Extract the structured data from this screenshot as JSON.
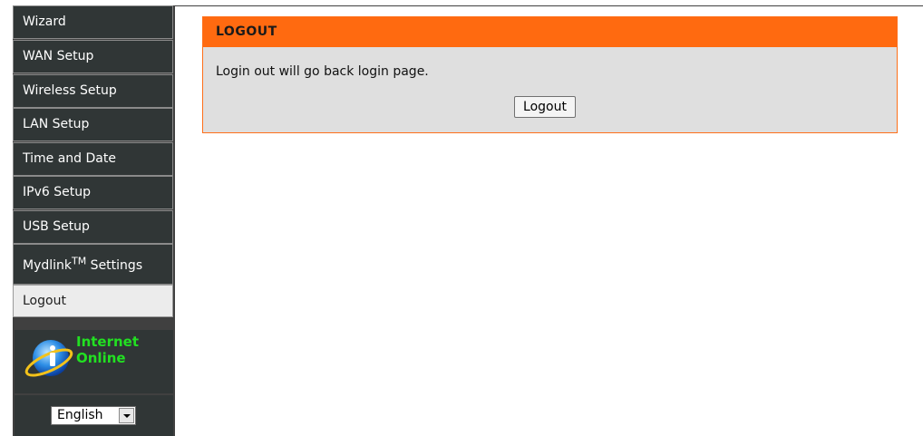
{
  "sidebar": {
    "items": [
      {
        "label": "Wizard"
      },
      {
        "label": "WAN Setup"
      },
      {
        "label": "Wireless Setup"
      },
      {
        "label": "LAN Setup"
      },
      {
        "label": "Time and Date"
      },
      {
        "label": "IPv6 Setup"
      },
      {
        "label": "USB Setup"
      },
      {
        "label": "Mydlink",
        "sup": "TM",
        "suffix": " Settings"
      },
      {
        "label": "Logout",
        "active": true
      }
    ],
    "status": {
      "line1": "Internet",
      "line2": "Online"
    },
    "language": {
      "selected": "English"
    }
  },
  "panel": {
    "title": "LOGOUT",
    "message": "Login out will go back login page.",
    "button_label": "Logout"
  },
  "colors": {
    "accent": "#ff6a10",
    "sidebar_bg": "#303636",
    "status_text": "#22e022"
  }
}
